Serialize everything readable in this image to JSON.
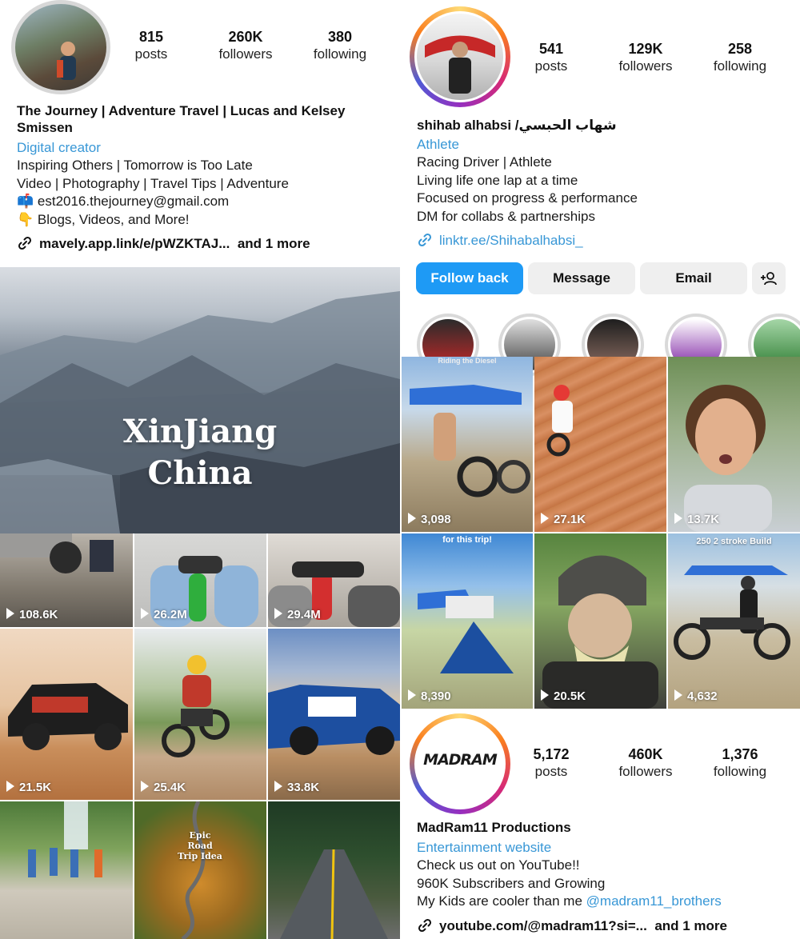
{
  "profiles": [
    {
      "stats": [
        {
          "num": "815",
          "label": "posts"
        },
        {
          "num": "260K",
          "label": "followers"
        },
        {
          "num": "380",
          "label": "following"
        }
      ],
      "name_line1": "The Journey | Adventure Travel | Lucas and Kelsey",
      "name_line2": "Smissen",
      "category": "Digital creator",
      "bio": [
        "Inspiring Others | Tomorrow is Too Late",
        "Video | Photography | Travel Tips | Adventure",
        "📫 est2016.thejourney@gmail.com",
        "👇 Blogs, Videos, and More!"
      ],
      "link": "mavely.app.link/e/pWZKTAJ...",
      "link_more": "and 1 more",
      "hero_title_1": "XinJiang",
      "hero_title_2": "China",
      "tiles": [
        {
          "views": "108.6K"
        },
        {
          "views": "26.2M"
        },
        {
          "views": "29.4M"
        },
        {
          "views": "21.5K"
        },
        {
          "views": "25.4K"
        },
        {
          "views": "33.8K"
        },
        {
          "views": ""
        },
        {
          "views": "",
          "overlay": "Epic Road Trip Idea"
        },
        {
          "views": ""
        }
      ]
    },
    {
      "stats": [
        {
          "num": "541",
          "label": "posts"
        },
        {
          "num": "129K",
          "label": "followers"
        },
        {
          "num": "258",
          "label": "following"
        }
      ],
      "name": "shihab alhabsi /شهاب الحبسي",
      "category": "Athlete",
      "bio": [
        "Racing Driver | Athlete",
        "Living life one lap at a time",
        "Focused on progress & performance",
        "DM for collabs & partnerships"
      ],
      "link": "linktr.ee/Shihabalhabsi_",
      "buttons": {
        "follow": "Follow back",
        "message": "Message",
        "email": "Email"
      },
      "tiles": [
        {
          "views": "3,098",
          "overlay": "Riding the Diesel"
        },
        {
          "views": "27.1K"
        },
        {
          "views": "13.7K"
        },
        {
          "views": "8,390",
          "overlay": "for this trip!"
        },
        {
          "views": "20.5K"
        },
        {
          "views": "4,632",
          "overlay": "250 2 stroke Build"
        }
      ]
    },
    {
      "stats": [
        {
          "num": "5,172",
          "label": "posts"
        },
        {
          "num": "460K",
          "label": "followers"
        },
        {
          "num": "1,376",
          "label": "following"
        }
      ],
      "logo_text": "MADRAM",
      "name": "MadRam11 Productions",
      "category": "Entertainment website",
      "bio": [
        "Check us out on YouTube!!",
        "960K Subscribers and Growing"
      ],
      "bio_mention_prefix": "My Kids are cooler than me ",
      "bio_mention": "@madram11_brothers",
      "link": "youtube.com/@madram11?si=...",
      "link_more": "and 1 more"
    }
  ],
  "colors": {
    "accent_blue": "#3897d6",
    "button_blue": "#1e9af5"
  }
}
